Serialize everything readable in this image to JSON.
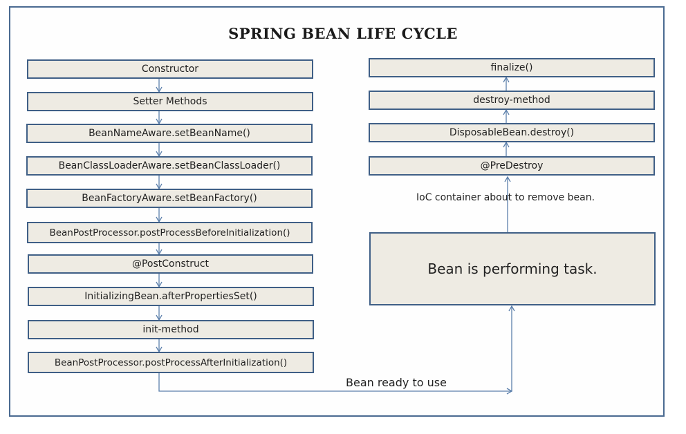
{
  "title": "SPRING BEAN LIFE CYCLE",
  "initialization_steps": [
    "Constructor",
    "Setter Methods",
    "BeanNameAware.setBeanName()",
    "BeanClassLoaderAware.setBeanClassLoader()",
    "BeanFactoryAware.setBeanFactory()",
    "BeanPostProcessor.postProcessBeforeInitialization()",
    "@PostConstruct",
    "InitializingBean.afterPropertiesSet()",
    "init-method",
    "BeanPostProcessor.postProcessAfterInitialization()"
  ],
  "destruction_steps": [
    "finalize()",
    "destroy-method",
    "DisposableBean.destroy()",
    "@PreDestroy"
  ],
  "task_box": "Bean is performing task.",
  "ready_label": "Bean ready to use",
  "remove_label": "IoC container about to remove bean.",
  "colors": {
    "box_fill": "#eeebe3",
    "box_border": "#3f5f86",
    "arrow": "#5b7fab",
    "frame_border": "#4a6a91"
  }
}
